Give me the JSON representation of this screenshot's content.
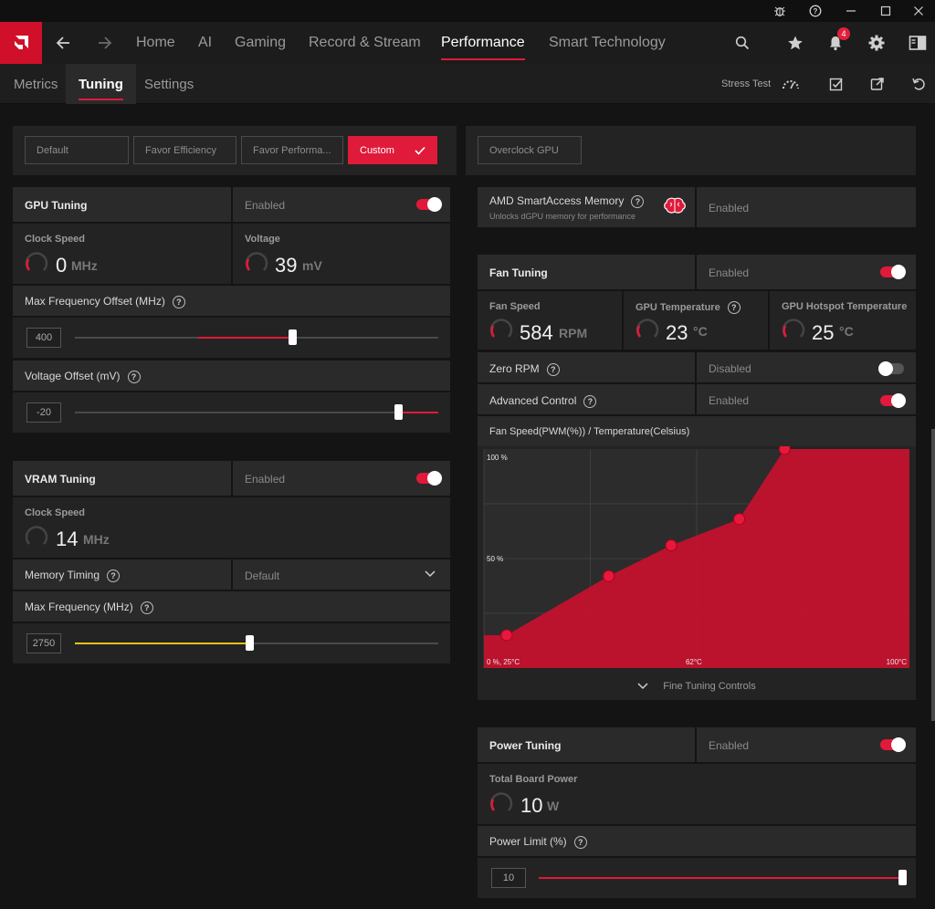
{
  "window": {
    "icons": [
      "bug-icon",
      "help-icon",
      "minimize-icon",
      "maximize-icon",
      "close-icon"
    ]
  },
  "nav": {
    "items": [
      "Home",
      "AI",
      "Gaming",
      "Record & Stream",
      "Performance",
      "Smart Technology"
    ],
    "active": "Performance",
    "notification_count": "4"
  },
  "subnav": {
    "items": [
      "Metrics",
      "Tuning",
      "Settings"
    ],
    "active": "Tuning",
    "stress_test": "Stress Test"
  },
  "presets": {
    "default": "Default",
    "favor_efficiency": "Favor Efficiency",
    "favor_performance": "Favor Performa...",
    "custom": "Custom",
    "overclock": "Overclock GPU"
  },
  "gpu_tuning": {
    "title": "GPU Tuning",
    "status": "Enabled",
    "enabled": true,
    "clock_label": "Clock Speed",
    "clock_value": "0",
    "clock_unit": "MHz",
    "voltage_label": "Voltage",
    "voltage_value": "39",
    "voltage_unit": "mV",
    "max_freq_label": "Max Frequency Offset (MHz)",
    "max_freq_value": "400",
    "max_freq_fraction": 0.6,
    "max_freq_zero_fraction": 0.34,
    "voltage_offset_label": "Voltage Offset (mV)",
    "voltage_offset_value": "-20",
    "voltage_offset_fraction": 0.89
  },
  "vram_tuning": {
    "title": "VRAM Tuning",
    "status": "Enabled",
    "enabled": true,
    "clock_label": "Clock Speed",
    "clock_value": "14",
    "clock_unit": "MHz",
    "memory_timing_label": "Memory Timing",
    "memory_timing_value": "Default",
    "max_freq_label": "Max Frequency (MHz)",
    "max_freq_value": "2750",
    "max_freq_fraction": 0.48
  },
  "smart_access": {
    "title": "AMD SmartAccess Memory",
    "subtitle": "Unlocks dGPU memory for performance",
    "status": "Enabled"
  },
  "fan_tuning": {
    "title": "Fan Tuning",
    "status": "Enabled",
    "enabled": true,
    "fan_speed_label": "Fan Speed",
    "fan_speed_value": "584",
    "fan_speed_unit": "RPM",
    "gpu_temp_label": "GPU Temperature",
    "gpu_temp_value": "23",
    "gpu_temp_unit": "°C",
    "hotspot_label": "GPU Hotspot Temperature",
    "hotspot_value": "25",
    "hotspot_unit": "°C",
    "zero_rpm_label": "Zero RPM",
    "zero_rpm_status": "Disabled",
    "zero_rpm_enabled": false,
    "advanced_label": "Advanced Control",
    "advanced_status": "Enabled",
    "advanced_enabled": true,
    "curve_title": "Fan Speed(PWM(%)) / Temperature(Celsius)",
    "fine_tuning": "Fine Tuning Controls"
  },
  "chart_data": {
    "type": "area",
    "title": "Fan Speed(PWM(%)) / Temperature(Celsius)",
    "x_min_label": "0 %, 25°C",
    "x_mid_label": "62°C",
    "x_max_label": "100°C",
    "y_top_label": "100 %",
    "y_mid_label": "50 %",
    "xlim": [
      25,
      100
    ],
    "ylim": [
      0,
      100
    ],
    "points": [
      {
        "x": 29,
        "y": 15
      },
      {
        "x": 47,
        "y": 42
      },
      {
        "x": 58,
        "y": 56
      },
      {
        "x": 70,
        "y": 68
      },
      {
        "x": 78,
        "y": 100
      }
    ],
    "color": "#c8102e"
  },
  "power_tuning": {
    "title": "Power Tuning",
    "status": "Enabled",
    "enabled": true,
    "tbp_label": "Total Board Power",
    "tbp_value": "10",
    "tbp_unit": "W",
    "limit_label": "Power Limit (%)",
    "limit_value": "10",
    "limit_fraction": 1.0
  },
  "colors": {
    "accent": "#e01a3a",
    "vram_slider": "#f0c020"
  }
}
